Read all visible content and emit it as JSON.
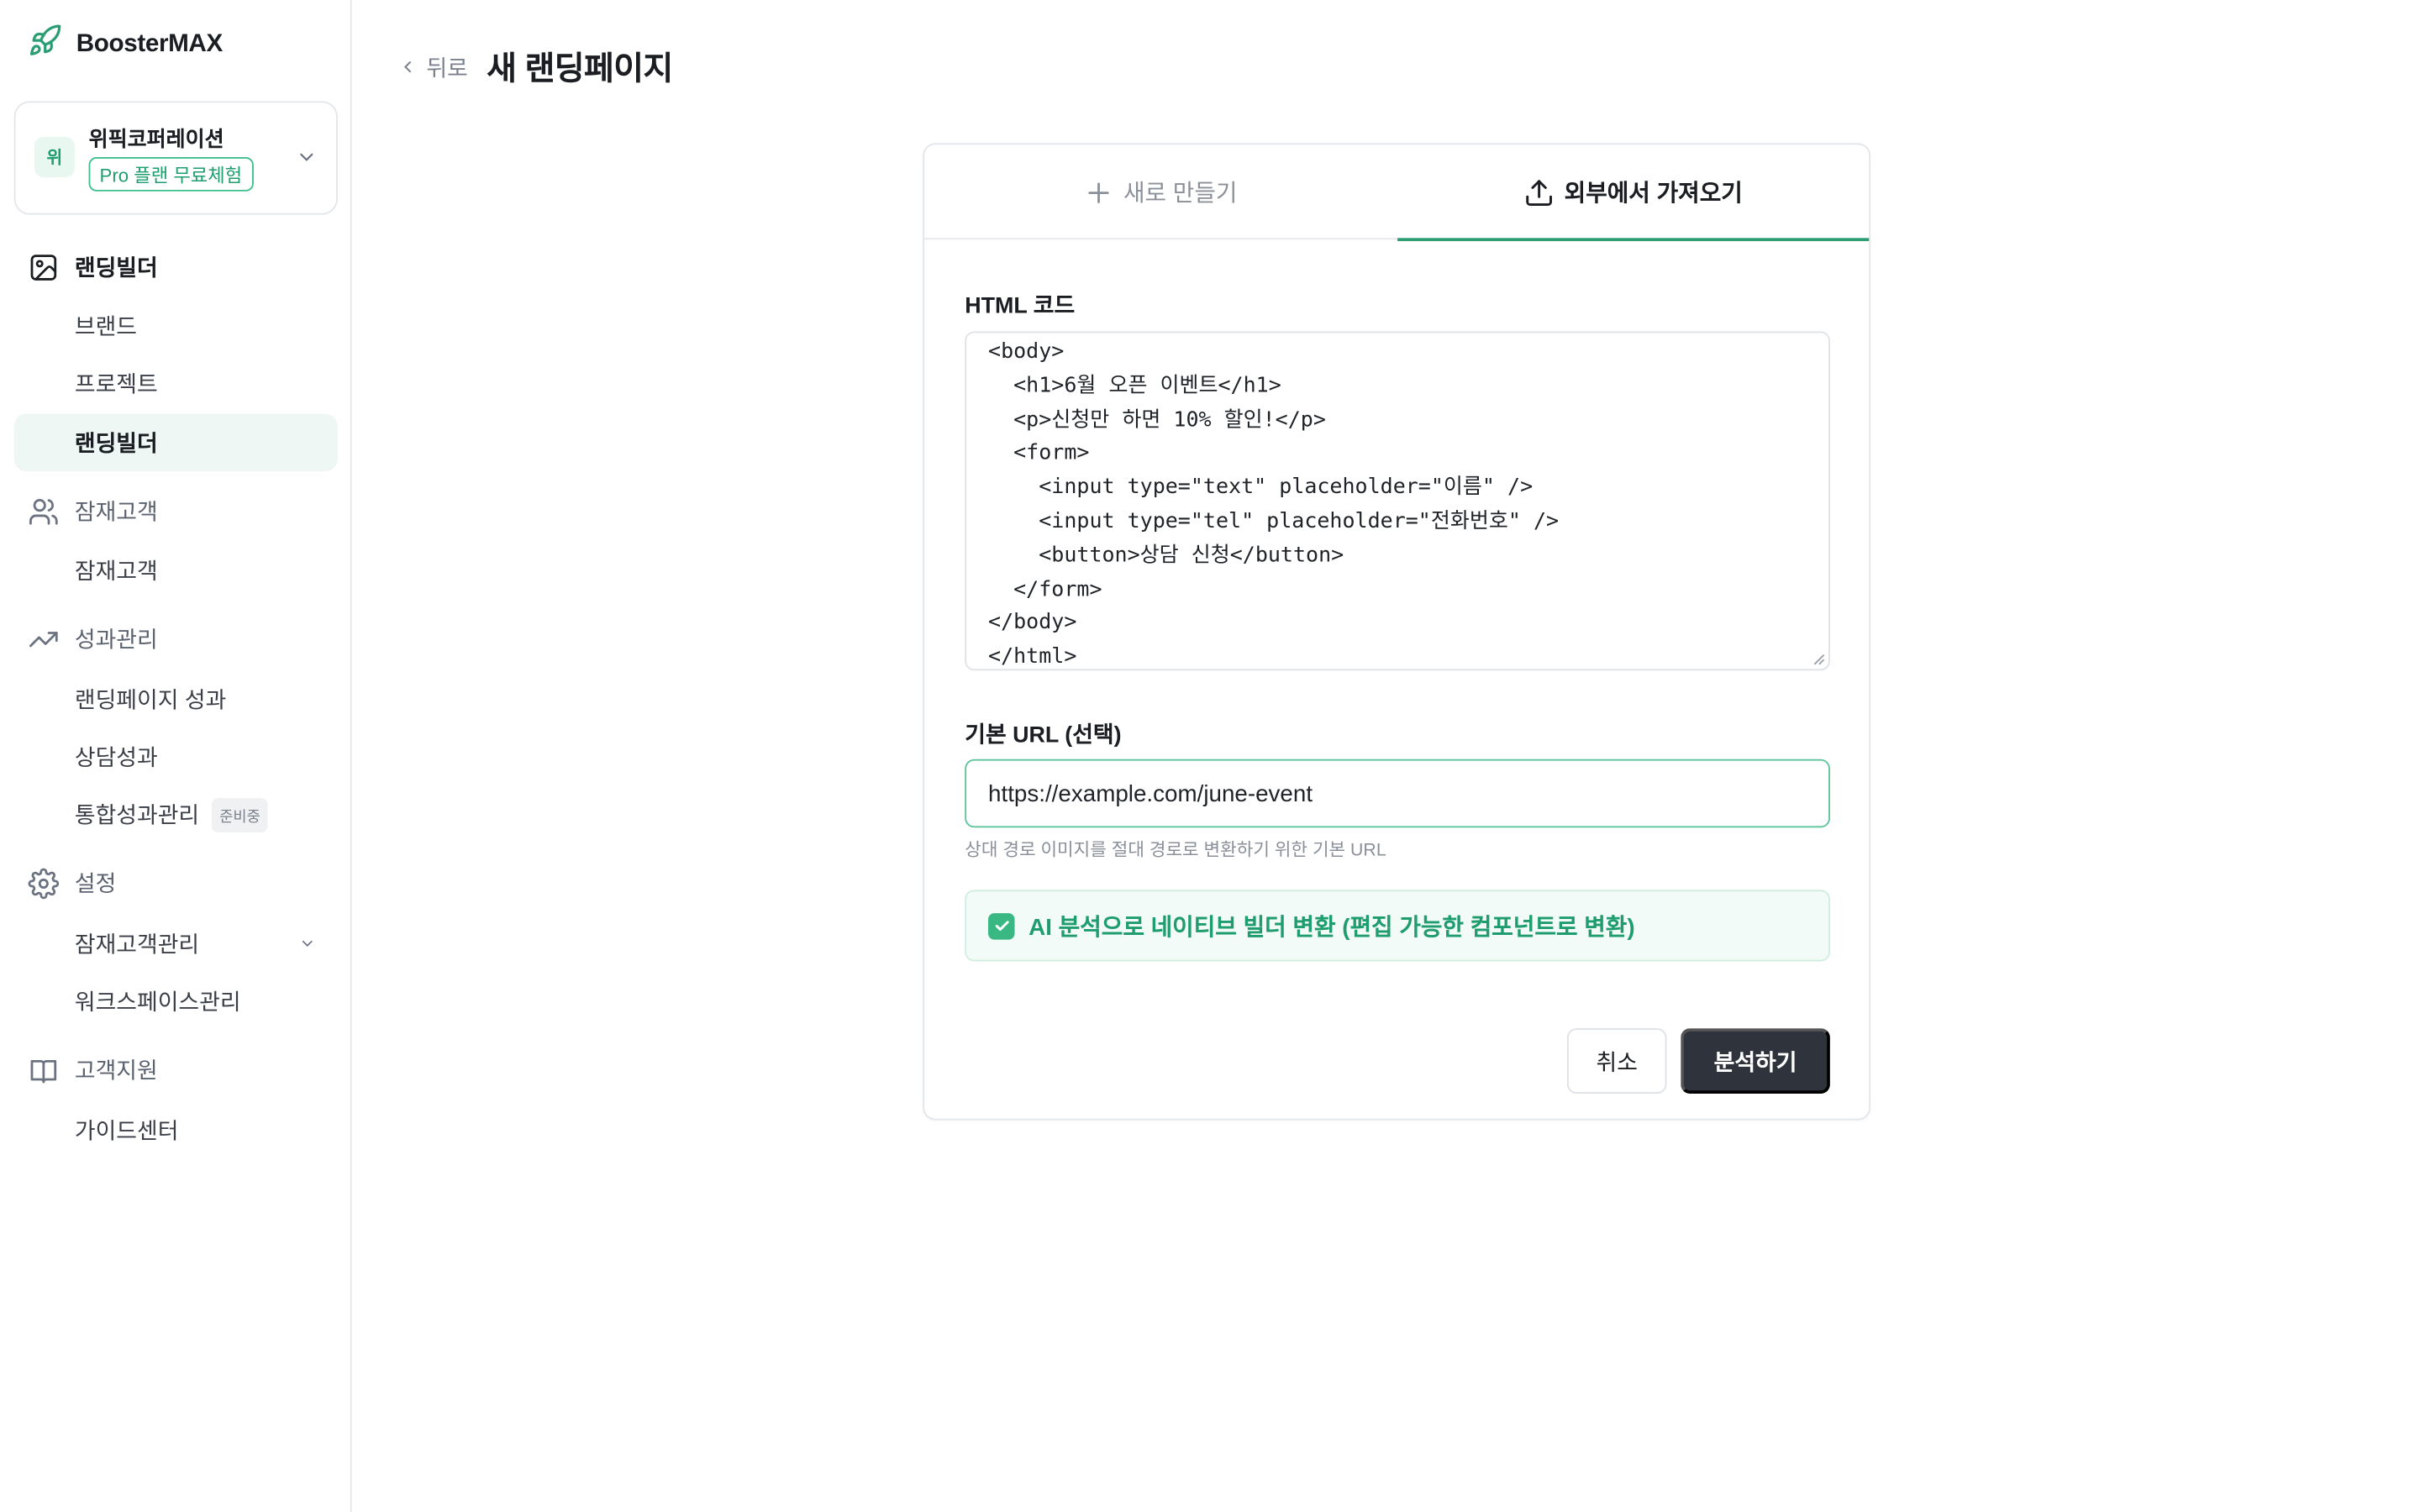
{
  "app": {
    "name": "BoosterMAX"
  },
  "workspace": {
    "avatar": "위",
    "name": "위픽코퍼레이션",
    "plan_badge": "Pro 플랜 무료체험"
  },
  "sidebar": {
    "sections": [
      {
        "label": "랜딩빌더",
        "icon": "image-icon"
      },
      {
        "label": "잠재고객",
        "icon": "users-icon"
      },
      {
        "label": "성과관리",
        "icon": "trending-up-icon"
      },
      {
        "label": "설정",
        "icon": "gear-icon"
      },
      {
        "label": "고객지원",
        "icon": "book-icon"
      }
    ],
    "items": {
      "brand": "브랜드",
      "project": "프로젝트",
      "landing_builder": "랜딩빌더",
      "leads": "잠재고객",
      "landing_performance": "랜딩페이지 성과",
      "consult_performance": "상담성과",
      "integrated_performance": "통합성과관리",
      "integrated_badge": "준비중",
      "lead_management": "잠재고객관리",
      "workspace_management": "워크스페이스관리",
      "guide_center": "가이드센터"
    }
  },
  "header": {
    "back_label": "뒤로",
    "title": "새 랜딩페이지"
  },
  "tabs": {
    "new_label": "새로 만들기",
    "import_label": "외부에서 가져오기",
    "active": "import"
  },
  "form": {
    "html_label": "HTML 코드",
    "html_code_lines": [
      "<body>",
      "  <h1>6월 오픈 이벤트</h1>",
      "  <p>신청만 하면 10% 할인!</p>",
      "  <form>",
      "    <input type=\"text\" placeholder=\"이름\" />",
      "    <input type=\"tel\" placeholder=\"전화번호\" />",
      "    <button>상담 신청</button>",
      "  </form>",
      "</body>",
      "</html>"
    ],
    "url_label": "기본 URL (선택)",
    "url_value": "https://example.com/june-event",
    "url_hint": "상대 경로 이미지를 절대 경로로 변환하기 위한 기본 URL",
    "ai_checkbox_label": "AI 분석으로 네이티브 빌더 변환 (편집 가능한 컴포넌트로 변환)",
    "ai_checked": true,
    "cancel_label": "취소",
    "analyze_label": "분석하기"
  },
  "colors": {
    "accent": "#2a9d73",
    "dark_button": "#2f343c",
    "active_nav_bg": "#eef7f3"
  }
}
